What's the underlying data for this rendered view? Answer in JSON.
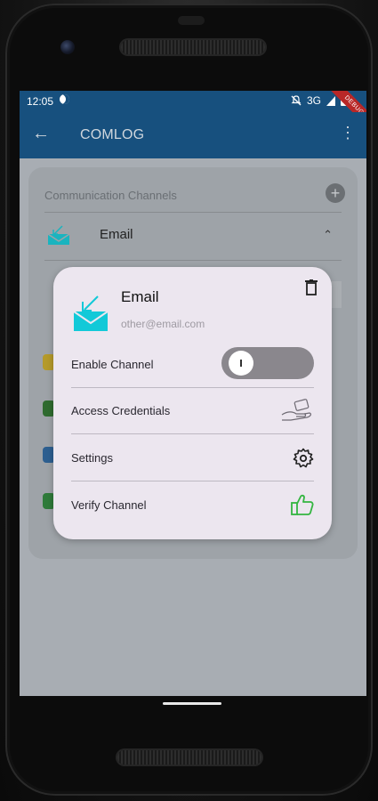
{
  "status_bar": {
    "time": "12:05",
    "network": "3G",
    "debug_label": "DEBUG"
  },
  "app_bar": {
    "title": "COMLOG",
    "back_icon": "back-arrow-icon",
    "menu_icon": "more-vert-icon"
  },
  "background_card": {
    "header": "Communication Channels",
    "add_icon": "add-circle-icon",
    "email_label": "Email",
    "chevron_icon": "chevron-up-icon"
  },
  "dialog": {
    "title": "Email",
    "subtitle": "other@email.com",
    "delete_icon": "trash-icon",
    "channel_icon": "email-inbox-icon",
    "rows": [
      {
        "label": "Enable Channel",
        "control": "toggle",
        "enabled": false
      },
      {
        "label": "Access Credentials",
        "icon": "hand-card-icon"
      },
      {
        "label": "Settings",
        "icon": "gear-icon"
      },
      {
        "label": "Verify Channel",
        "icon": "thumbs-up-icon",
        "icon_color": "#33b540"
      }
    ]
  },
  "colors": {
    "app_bar": "#17507e",
    "dialog_bg": "#ece6ef",
    "email_icon": "#12c9d8",
    "verify_icon": "#33b540"
  }
}
